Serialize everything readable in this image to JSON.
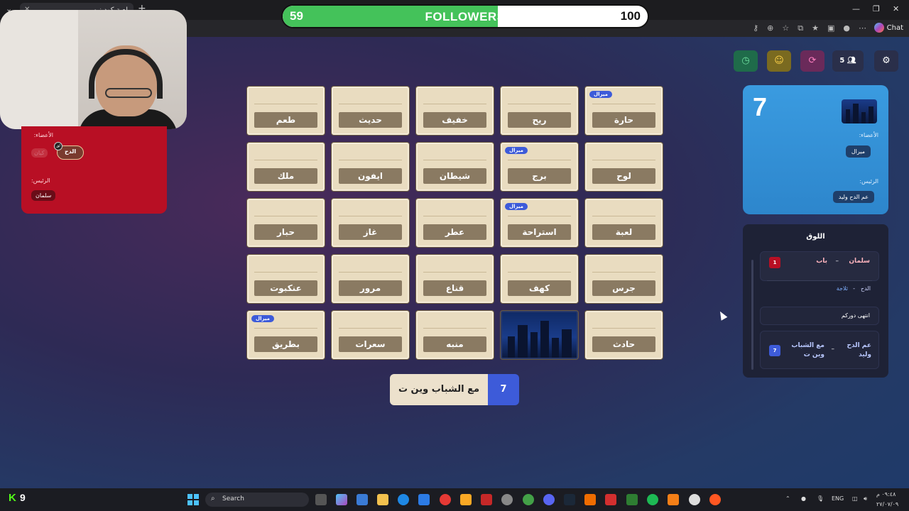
{
  "browser": {
    "tab_title": "لعبة كود نيم",
    "tab_close": "✕",
    "new_tab": "+",
    "chat_label": "Chat"
  },
  "followers_bar": {
    "current": "59",
    "label": "FOLLOWERS",
    "goal": "100",
    "progress_fraction": 0.59,
    "fill_color": "#44c25a"
  },
  "red_team": {
    "members_label": ":الأعضاء",
    "member": "الدح",
    "faded_member": "كيان",
    "badge_text": "لق",
    "leader_label": ":الرئيس",
    "leader": "سلمان",
    "color": "#b80f24"
  },
  "board": {
    "cards": [
      {
        "word": "طعم",
        "voter": ""
      },
      {
        "word": "حديث",
        "voter": ""
      },
      {
        "word": "خفيف",
        "voter": ""
      },
      {
        "word": "ريح",
        "voter": ""
      },
      {
        "word": "حارة",
        "voter": "ميرال"
      },
      {
        "word": "ملك",
        "voter": ""
      },
      {
        "word": "ايفون",
        "voter": ""
      },
      {
        "word": "شيطان",
        "voter": ""
      },
      {
        "word": "برج",
        "voter": "ميرال"
      },
      {
        "word": "لوح",
        "voter": ""
      },
      {
        "word": "حبار",
        "voter": ""
      },
      {
        "word": "غاز",
        "voter": ""
      },
      {
        "word": "عطر",
        "voter": ""
      },
      {
        "word": "استراحة",
        "voter": "ميرال"
      },
      {
        "word": "لعبة",
        "voter": ""
      },
      {
        "word": "عنكبوت",
        "voter": ""
      },
      {
        "word": "مرور",
        "voter": ""
      },
      {
        "word": "قناع",
        "voter": ""
      },
      {
        "word": "كهف",
        "voter": ""
      },
      {
        "word": "جرس",
        "voter": ""
      },
      {
        "word": "بطريق",
        "voter": "ميرال"
      },
      {
        "word": "سعرات",
        "voter": ""
      },
      {
        "word": "منبه",
        "voter": ""
      },
      {
        "word": "",
        "voter": "",
        "revealed": true
      },
      {
        "word": "حادث",
        "voter": ""
      }
    ]
  },
  "clue": {
    "text": "مع الشباب وين ت",
    "count": "7"
  },
  "controls": {
    "players_count": "5",
    "timer_icon": "clock-icon",
    "emoji_icon": "smile-icon",
    "refresh_icon": "refresh-icon",
    "users_icon": "users-icon",
    "settings_icon": "gear-icon"
  },
  "blue_team": {
    "score": "7",
    "members_label": ":الأعضاء",
    "member": "ميرال",
    "leader_label": ":الرئيس",
    "leader": "عم الدح وليد",
    "color": "#3a9be0"
  },
  "log": {
    "title": "اللوق",
    "entries": [
      {
        "player": "سلمان",
        "dash": "–",
        "word": "باب",
        "num": "1"
      },
      {
        "player": "الدح",
        "dash": "-",
        "word": "ثلاجة"
      },
      {
        "text": "انتهى دوركم"
      },
      {
        "player": "عم الدح وليد",
        "dash": "–",
        "word": "مع الشباب وين ت",
        "num": "7"
      }
    ]
  },
  "taskbar": {
    "kick_logo": "K",
    "kick_count": "9",
    "search_placeholder": "Search",
    "lang": "ENG",
    "time": "٠٩:٤٨ م",
    "date": "٢٧/٠٧/٠٩"
  }
}
